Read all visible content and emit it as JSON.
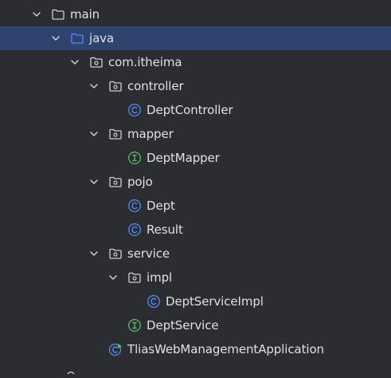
{
  "colors": {
    "background": "#2b2d30",
    "selection": "#2e436e",
    "text": "#dfe1e5",
    "arrow": "#ced0d6",
    "folder_icon": "#ced0d6",
    "source_folder_icon": "#548af7",
    "class_icon": "#548af7",
    "interface_icon": "#5fb865",
    "run_badge": "#5fb865"
  },
  "tree": {
    "selected_item": "java",
    "items": [
      {
        "label": "main",
        "icon": "folder-icon",
        "expanded": true
      },
      {
        "label": "java",
        "icon": "source-folder-icon",
        "expanded": true,
        "selected": true
      },
      {
        "label": "com.itheima",
        "icon": "package-icon",
        "expanded": true
      },
      {
        "label": "controller",
        "icon": "package-icon",
        "expanded": true
      },
      {
        "label": "DeptController",
        "icon": "class-icon"
      },
      {
        "label": "mapper",
        "icon": "package-icon",
        "expanded": true
      },
      {
        "label": "DeptMapper",
        "icon": "interface-icon"
      },
      {
        "label": "pojo",
        "icon": "package-icon",
        "expanded": true
      },
      {
        "label": "Dept",
        "icon": "class-icon"
      },
      {
        "label": "Result",
        "icon": "class-icon"
      },
      {
        "label": "service",
        "icon": "package-icon",
        "expanded": true
      },
      {
        "label": "impl",
        "icon": "package-icon",
        "expanded": true
      },
      {
        "label": "DeptServiceImpl",
        "icon": "class-icon"
      },
      {
        "label": "DeptService",
        "icon": "interface-icon"
      },
      {
        "label": "TliasWebManagementApplication",
        "icon": "spring-boot-class-icon"
      }
    ]
  }
}
